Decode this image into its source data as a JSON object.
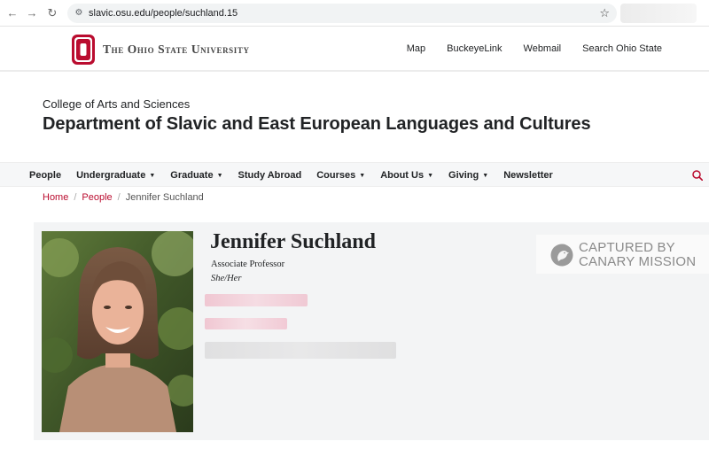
{
  "browser": {
    "url": "slavic.osu.edu/people/suchland.15"
  },
  "osu": {
    "wordmark": "The Ohio State University",
    "links": [
      "Map",
      "BuckeyeLink",
      "Webmail",
      "Search Ohio State"
    ]
  },
  "site": {
    "college": "College of Arts and Sciences",
    "department": "Department of Slavic and East European Languages and Cultures"
  },
  "nav": {
    "items": [
      {
        "label": "People",
        "dropdown": false
      },
      {
        "label": "Undergraduate",
        "dropdown": true
      },
      {
        "label": "Graduate",
        "dropdown": true
      },
      {
        "label": "Study Abroad",
        "dropdown": false
      },
      {
        "label": "Courses",
        "dropdown": true
      },
      {
        "label": "About Us",
        "dropdown": true
      },
      {
        "label": "Giving",
        "dropdown": true
      },
      {
        "label": "Newsletter",
        "dropdown": false
      }
    ]
  },
  "breadcrumb": {
    "home": "Home",
    "people": "People",
    "current": "Jennifer Suchland",
    "separator": "/"
  },
  "profile": {
    "name": "Jennifer Suchland",
    "title": "Associate Professor",
    "pronouns": "She/Her"
  },
  "watermark": {
    "line1": "CAPTURED BY",
    "line2": "CANARY MISSION"
  },
  "colors": {
    "scarlet": "#ba0c2f",
    "gray": "#212325"
  }
}
